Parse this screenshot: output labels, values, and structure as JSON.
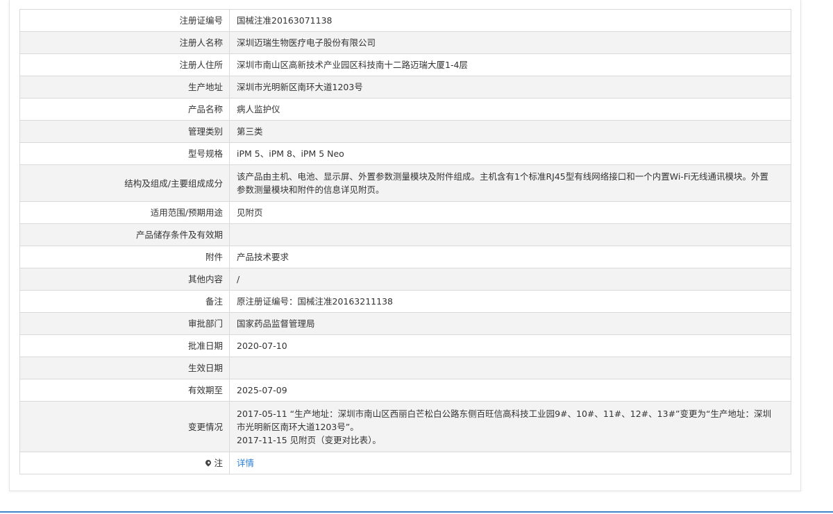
{
  "rows": [
    {
      "label": "注册证编号",
      "value": "国械注准20163071138"
    },
    {
      "label": "注册人名称",
      "value": "深圳迈瑞生物医疗电子股份有限公司"
    },
    {
      "label": "注册人住所",
      "value": "深圳市南山区高新技术产业园区科技南十二路迈瑞大厦1-4层"
    },
    {
      "label": "生产地址",
      "value": "深圳市光明新区南环大道1203号"
    },
    {
      "label": "产品名称",
      "value": "病人监护仪"
    },
    {
      "label": "管理类别",
      "value": "第三类"
    },
    {
      "label": "型号规格",
      "value": "iPM 5、iPM 8、iPM 5 Neo"
    },
    {
      "label": "结构及组成/主要组成成分",
      "value": "该产品由主机、电池、显示屏、外置参数测量模块及附件组成。主机含有1个标准RJ45型有线网络接口和一个内置Wi-Fi无线通讯模块。外置参数测量模块和附件的信息详见附页。"
    },
    {
      "label": "适用范围/预期用途",
      "value": "见附页"
    },
    {
      "label": "产品储存条件及有效期",
      "value": ""
    },
    {
      "label": "附件",
      "value": "产品技术要求"
    },
    {
      "label": "其他内容",
      "value": "/"
    },
    {
      "label": "备注",
      "value": "原注册证编号：国械注准20163211138"
    },
    {
      "label": "审批部门",
      "value": "国家药品监督管理局"
    },
    {
      "label": "批准日期",
      "value": "2020-07-10"
    },
    {
      "label": "生效日期",
      "value": ""
    },
    {
      "label": "有效期至",
      "value": "2025-07-09"
    },
    {
      "label": "变更情况",
      "value": "2017-05-11 “生产地址：深圳市南山区西丽白芒松白公路东侧百旺信高科技工业园9#、10#、11#、12#、13#”变更为“生产地址：深圳市光明新区南环大道1203号”。\n2017-11-15 见附页（变更对比表）。"
    }
  ],
  "note": {
    "label": "注",
    "icon": "map-pin-icon",
    "link_text": "详情"
  },
  "colors": {
    "link": "#2a7ed3",
    "border": "#d9d9d9",
    "stripe": "#f3f3f3",
    "footer_line": "#3f87c6"
  }
}
